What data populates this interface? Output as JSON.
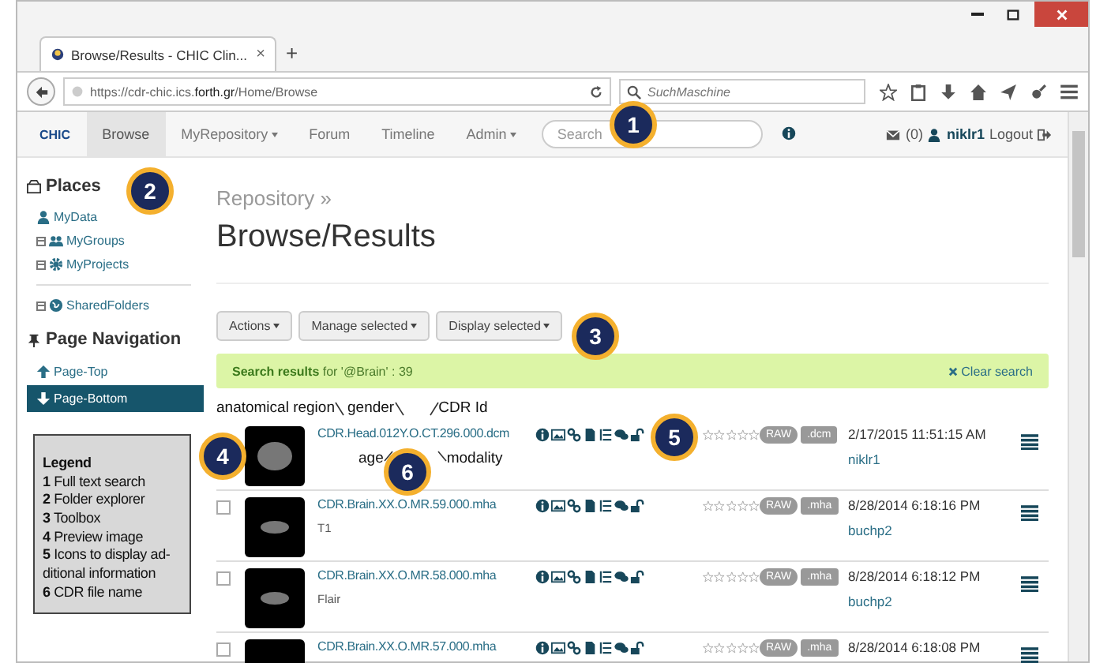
{
  "browser": {
    "tab_title": "Browse/Results - CHIC Clin...",
    "tab_close": "×",
    "new_tab": "+",
    "url": {
      "prefix": "https://cdr-chic.ics.",
      "domain": "forth.gr",
      "path": "/Home/Browse"
    },
    "search_placeholder": "SuchMaschine"
  },
  "navbar": {
    "logo": "CHIC",
    "items": [
      {
        "label": "Browse",
        "selected": true,
        "dropdown": false
      },
      {
        "label": "MyRepository",
        "selected": false,
        "dropdown": true
      },
      {
        "label": "Forum",
        "selected": false,
        "dropdown": false
      },
      {
        "label": "Timeline",
        "selected": false,
        "dropdown": false
      },
      {
        "label": "Admin",
        "selected": false,
        "dropdown": true
      }
    ],
    "search_placeholder": "Search",
    "messages": "(0)",
    "user": "niklr1",
    "logout": "Logout"
  },
  "sidebar": {
    "places_title": "Places",
    "places": [
      {
        "label": "MyData",
        "kind": "user",
        "expandable": false
      },
      {
        "label": "MyGroups",
        "kind": "group",
        "expandable": true
      },
      {
        "label": "MyProjects",
        "kind": "gear",
        "expandable": true
      },
      {
        "label": "SharedFolders",
        "kind": "globe",
        "expandable": true
      }
    ],
    "nav_title": "Page Navigation",
    "nav": [
      {
        "label": "Page-Top",
        "kind": "up",
        "selected": false
      },
      {
        "label": "Page-Bottom",
        "kind": "down",
        "selected": true
      }
    ]
  },
  "legend": {
    "title": "Legend",
    "items": [
      {
        "number": "1",
        "text": "Full text search"
      },
      {
        "number": "2",
        "text": "Folder explorer"
      },
      {
        "number": "3",
        "text": "Toolbox"
      },
      {
        "number": "4",
        "text": "Preview image"
      },
      {
        "number": "5",
        "text": "Icons to display ad-ditional information"
      },
      {
        "number": "6",
        "text": "CDR file name"
      }
    ]
  },
  "main": {
    "breadcrumb": "Repository »",
    "title": "Browse/Results",
    "toolbar": [
      "Actions",
      "Manage selected",
      "Display selected"
    ],
    "search_result": "**Search results** for '@Brain' : 39",
    "clear_search": "Clear search"
  },
  "annotations": {
    "top": [
      "anatomical region",
      "gender",
      "CDR Id"
    ],
    "bottom": [
      "age",
      "modality"
    ]
  },
  "rows": [
    {
      "name": "CDR.Head.012Y.O.CT.296.000.dcm",
      "description": "",
      "stars": 0,
      "tags": [
        "RAW",
        ".dcm"
      ],
      "date": "2/17/2015 11:51:15 AM",
      "owner": "niklr1"
    },
    {
      "name": "CDR.Brain.XX.O.MR.59.000.mha",
      "description": "T1",
      "checked": false,
      "stars": 0,
      "tags": [
        "RAW",
        ".mha"
      ],
      "date": "8/28/2014 6:18:16 PM",
      "owner": "buchp2"
    },
    {
      "name": "CDR.Brain.XX.O.MR.58.000.mha",
      "description": "Flair",
      "checked": false,
      "stars": 0,
      "tags": [
        "RAW",
        ".mha"
      ],
      "date": "8/28/2014 6:18:12 PM",
      "owner": "buchp2"
    },
    {
      "name": "CDR.Brain.XX.O.MR.57.000.mha",
      "description": "",
      "checked": false,
      "stars": 0,
      "tags": [
        "RAW",
        ".mha"
      ],
      "date": "8/28/2014 6:18:08 PM",
      "owner": ""
    }
  ],
  "callouts": [
    "1",
    "2",
    "3",
    "4",
    "5",
    "6"
  ]
}
